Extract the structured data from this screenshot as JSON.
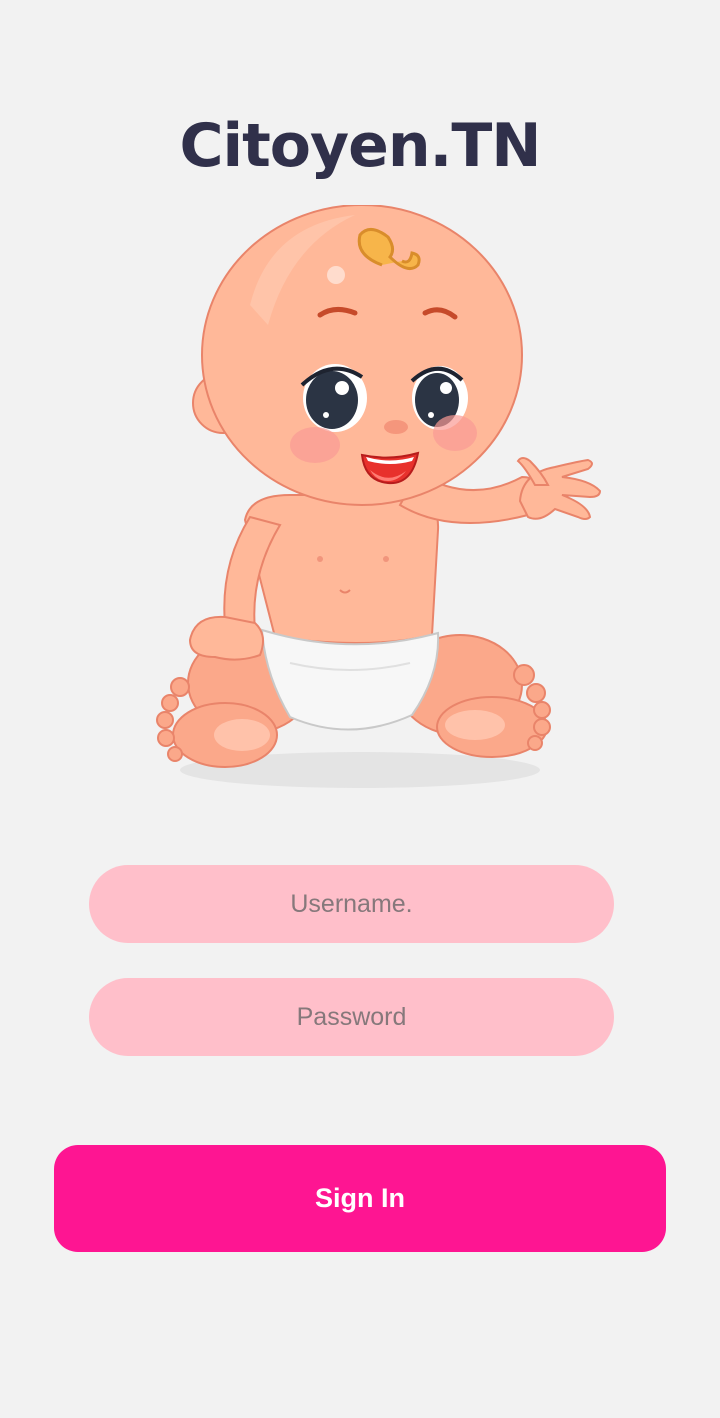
{
  "app": {
    "title": "Citoyen.TN"
  },
  "illustration": {
    "icon": "baby-waving-illustration"
  },
  "form": {
    "username_placeholder": "Username.",
    "password_placeholder": "Password",
    "signin_label": "Sign In"
  },
  "colors": {
    "background": "#f2f2f2",
    "title": "#30304a",
    "field_background": "#ffbfca",
    "accent": "#fe1592"
  }
}
